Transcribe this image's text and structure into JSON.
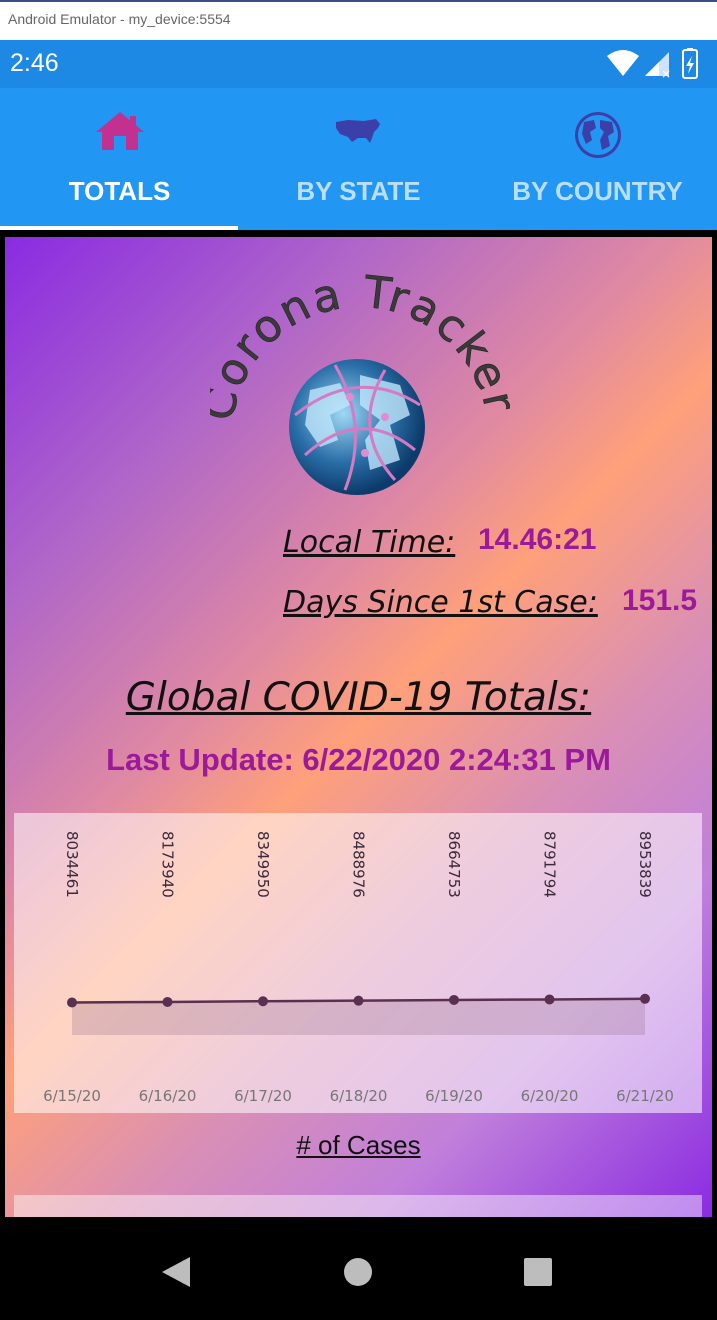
{
  "window": {
    "title": "Android Emulator - my_device:5554"
  },
  "status_bar": {
    "time": "2:46"
  },
  "tabs": [
    {
      "label": "TOTALS",
      "icon": "home-icon",
      "active": true
    },
    {
      "label": "BY STATE",
      "icon": "usa-map-icon",
      "active": false
    },
    {
      "label": "BY COUNTRY",
      "icon": "globe-icon",
      "active": false
    }
  ],
  "logo": {
    "text": "Corona Tracker"
  },
  "info": {
    "local_time_label": "Local Time:",
    "local_time_value": "14.46:21",
    "days_label": "Days Since 1st Case:",
    "days_value": "151.5"
  },
  "global": {
    "title": "Global COVID-19 Totals:",
    "last_update": "Last Update: 6/22/2020 2:24:31 PM"
  },
  "chart_caption": "# of Cases",
  "colors": {
    "tab_bar": "#2196f3",
    "status_bar": "#1e88e5",
    "accent_value": "#9a1a9a",
    "line": "#5a3050"
  },
  "chart_data": {
    "type": "area",
    "categories": [
      "6/15/20",
      "6/16/20",
      "6/17/20",
      "6/18/20",
      "6/19/20",
      "6/20/20",
      "6/21/20"
    ],
    "series": [
      {
        "values": [
          8034461,
          8173940,
          8349950,
          8488976,
          8664753,
          8791794,
          8953839
        ]
      }
    ],
    "data_labels": [
      "8034461",
      "8173940",
      "8349950",
      "8488976",
      "8664753",
      "8791794",
      "8953839"
    ],
    "ylim": [
      0,
      45000000
    ],
    "grid": false,
    "legend": "none"
  }
}
